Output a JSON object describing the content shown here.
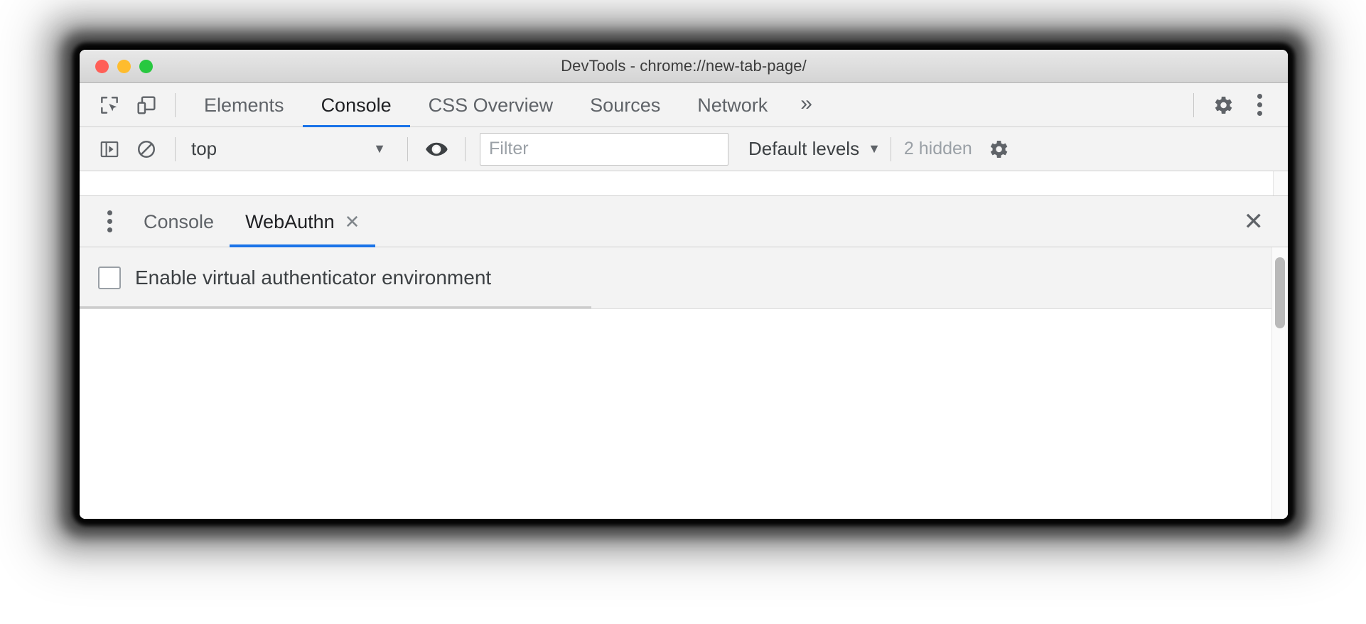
{
  "window": {
    "title": "DevTools - chrome://new-tab-page/",
    "traffic_lights": {
      "close_label": "close",
      "minimize_label": "minimize",
      "zoom_label": "zoom"
    }
  },
  "main_toolbar": {
    "inspect_icon": "inspect-element-cursor-icon",
    "device_icon": "device-toolbar-icon",
    "tabs": [
      {
        "label": "Elements",
        "active": false
      },
      {
        "label": "Console",
        "active": true
      },
      {
        "label": "CSS Overview",
        "active": false
      },
      {
        "label": "Sources",
        "active": false
      },
      {
        "label": "Network",
        "active": false
      }
    ],
    "more_tabs_label": "»",
    "settings_icon": "gear-icon",
    "main_menu_icon": "kebab-menu-icon"
  },
  "console_toolbar": {
    "sidebar_toggle_icon": "console-sidebar-toggle-icon",
    "clear_console_icon": "clear-console-icon",
    "context_value": "top",
    "context_caret": "▼",
    "live_expression_icon": "eye-icon",
    "filter_placeholder": "Filter",
    "filter_value": "",
    "levels_label": "Default levels",
    "levels_caret": "▼",
    "hidden_count_label": "2 hidden",
    "console_settings_icon": "gear-icon"
  },
  "drawer": {
    "more_tools_icon": "kebab-menu-icon",
    "tabs": [
      {
        "label": "Console",
        "active": false,
        "closable": false
      },
      {
        "label": "WebAuthn",
        "active": true,
        "closable": true,
        "close_glyph": "✕"
      }
    ],
    "close_drawer_glyph": "✕"
  },
  "webauthn": {
    "enable_checkbox_label": "Enable virtual authenticator environment",
    "enable_checkbox_checked": false
  },
  "colors": {
    "accent": "#1a73e8",
    "toolbar_bg": "#f3f3f3",
    "titlebar_top": "#e8e8e8",
    "titlebar_bottom": "#d4d4d4",
    "text_primary": "#202124",
    "text_secondary": "#5f6368",
    "muted": "#9aa0a6",
    "traffic_red": "#ff5f57",
    "traffic_yellow": "#febc2e",
    "traffic_green": "#28c840"
  }
}
